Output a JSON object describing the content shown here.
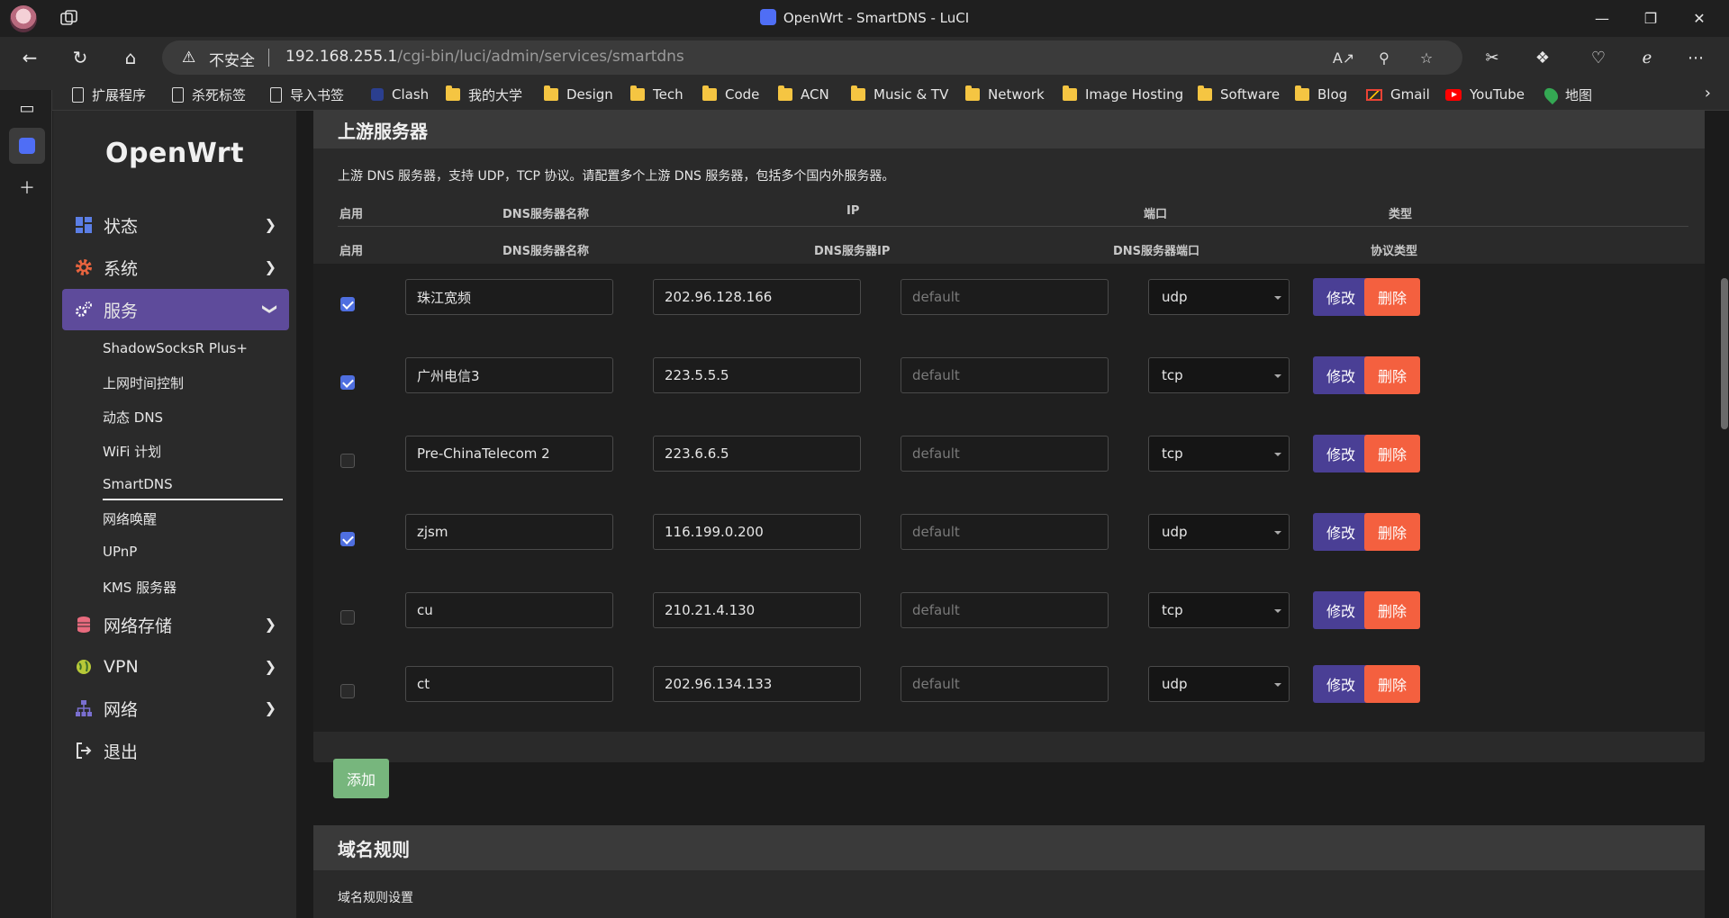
{
  "browser": {
    "window_title": "OpenWrt - SmartDNS - LuCI",
    "insecure_label": "不安全",
    "url_host": "192.168.255.1",
    "url_path": "/cgi-bin/luci/admin/services/smartdns",
    "bookmarks": [
      {
        "label": "扩展程序",
        "icon": "page-icon"
      },
      {
        "label": "杀死标签",
        "icon": "page-icon"
      },
      {
        "label": "导入书签",
        "icon": "page-icon"
      },
      {
        "label": "Clash",
        "icon": "clash-icon"
      },
      {
        "label": "我的大学",
        "icon": "folder-icon"
      },
      {
        "label": "Design",
        "icon": "folder-icon"
      },
      {
        "label": "Tech",
        "icon": "folder-icon"
      },
      {
        "label": "Code",
        "icon": "folder-icon"
      },
      {
        "label": "ACN",
        "icon": "folder-icon"
      },
      {
        "label": "Music & TV",
        "icon": "folder-icon"
      },
      {
        "label": "Network",
        "icon": "folder-icon"
      },
      {
        "label": "Image Hosting",
        "icon": "folder-icon"
      },
      {
        "label": "Software",
        "icon": "folder-icon"
      },
      {
        "label": "Blog",
        "icon": "folder-icon"
      },
      {
        "label": "Gmail",
        "icon": "gmail-icon"
      },
      {
        "label": "YouTube",
        "icon": "youtube-icon"
      },
      {
        "label": "地图",
        "icon": "maps-icon"
      }
    ]
  },
  "sidebar": {
    "logo": "OpenWrt",
    "menu": [
      {
        "label": "状态",
        "icon": "dashboard-icon"
      },
      {
        "label": "系统",
        "icon": "gear-icon"
      },
      {
        "label": "服务",
        "icon": "gears-icon"
      },
      {
        "label": "网络存储",
        "icon": "database-icon"
      },
      {
        "label": "VPN",
        "icon": "globe-icon"
      },
      {
        "label": "网络",
        "icon": "sitemap-icon"
      },
      {
        "label": "退出",
        "icon": "logout-icon"
      }
    ],
    "services_submenu": [
      "ShadowSocksR Plus+",
      "上网时间控制",
      "动态 DNS",
      "WiFi 计划",
      "SmartDNS",
      "网络唤醒",
      "UPnP",
      "KMS 服务器"
    ]
  },
  "upstream": {
    "title": "上游服务器",
    "description": "上游 DNS 服务器，支持 UDP，TCP 协议。请配置多个上游 DNS 服务器，包括多个国内外服务器。",
    "headers": [
      "启用",
      "DNS服务器名称",
      "IP",
      "端口",
      "类型"
    ],
    "subheaders": [
      "启用",
      "DNS服务器名称",
      "DNS服务器IP",
      "DNS服务器端口",
      "协议类型"
    ],
    "port_placeholder": "default",
    "edit_label": "修改",
    "delete_label": "删除",
    "add_label": "添加",
    "rows": [
      {
        "enabled": true,
        "name": "珠江宽频",
        "ip": "202.96.128.166",
        "port": "",
        "type": "udp"
      },
      {
        "enabled": true,
        "name": "广州电信3",
        "ip": "223.5.5.5",
        "port": "",
        "type": "tcp"
      },
      {
        "enabled": false,
        "name": "Pre-ChinaTelecom 2",
        "ip": "223.6.6.5",
        "port": "",
        "type": "tcp"
      },
      {
        "enabled": true,
        "name": "zjsm",
        "ip": "116.199.0.200",
        "port": "",
        "type": "udp"
      },
      {
        "enabled": false,
        "name": "cu",
        "ip": "210.21.4.130",
        "port": "",
        "type": "tcp"
      },
      {
        "enabled": false,
        "name": "ct",
        "ip": "202.96.134.133",
        "port": "",
        "type": "udp"
      }
    ]
  },
  "domain_rules": {
    "title": "域名规则",
    "description": "域名规则设置"
  },
  "colors": {
    "accent": "#5e4b9b",
    "delete": "#f4603f",
    "add": "#77b67d",
    "checkbox": "#4f6fe0"
  }
}
